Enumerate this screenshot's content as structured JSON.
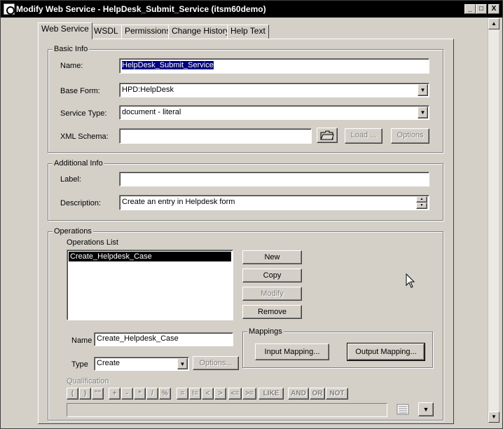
{
  "window": {
    "title": "Modify Web Service - HelpDesk_Submit_Service (itsm60demo)",
    "controls": {
      "minimize": "_",
      "maximize": "□",
      "close": "X"
    }
  },
  "tabs": [
    {
      "label": "Web Service",
      "active": true
    },
    {
      "label": "WSDL",
      "active": false
    },
    {
      "label": "Permissions",
      "active": false
    },
    {
      "label": "Change History",
      "active": false
    },
    {
      "label": "Help Text",
      "active": false
    }
  ],
  "basic_info": {
    "group_label": "Basic Info",
    "name_label": "Name:",
    "name_value": "HelpDesk_Submit_Service",
    "base_form_label": "Base Form:",
    "base_form_value": "HPD:HelpDesk",
    "service_type_label": "Service Type:",
    "service_type_value": "document - literal",
    "xml_schema_label": "XML Schema:",
    "xml_schema_value": "",
    "load_button": "Load ...",
    "options_button": "Options"
  },
  "additional_info": {
    "group_label": "Additional Info",
    "label_label": "Label:",
    "label_value": "",
    "description_label": "Description:",
    "description_value": "Create an entry in Helpdesk form"
  },
  "operations": {
    "group_label": "Operations",
    "list_label": "Operations List",
    "list_items": [
      {
        "label": "Create_Helpdesk_Case",
        "selected": true
      }
    ],
    "new_button": "New",
    "copy_button": "Copy",
    "modify_button": "Modify",
    "remove_button": "Remove",
    "name_label": "Name",
    "name_value": "Create_Helpdesk_Case",
    "type_label": "Type",
    "type_value": "Create",
    "type_options_button": "Options...",
    "mappings_label": "Mappings",
    "input_mapping_button": "Input Mapping...",
    "output_mapping_button": "Output Mapping...",
    "qualification_label": "Qualification",
    "qualification_value": "",
    "qualification_ops": [
      "(",
      ")",
      "\"\"",
      "+",
      "-",
      "*",
      "/",
      "%",
      "=",
      "!=",
      "<",
      ">",
      "<=",
      ">=",
      "LIKE",
      "AND",
      "OR",
      "NOT"
    ]
  }
}
